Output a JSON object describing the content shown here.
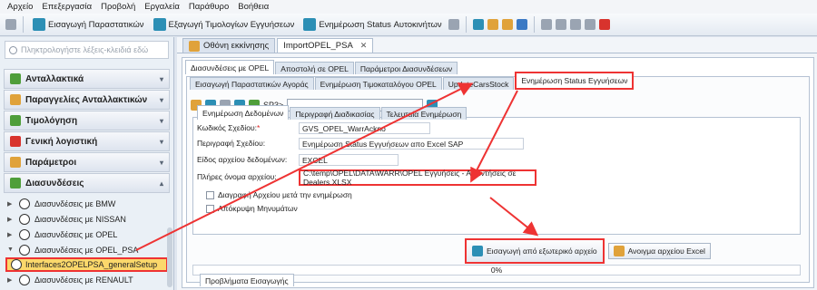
{
  "menu": [
    "Αρχείο",
    "Επεξεργασία",
    "Προβολή",
    "Εργαλεία",
    "Παράθυρο",
    "Βοήθεια"
  ],
  "toolbar": {
    "import_label": "Εισαγωγή Παραστατικών",
    "export_label": "Εξαγωγή Τιμολογίων Εγγυήσεων",
    "status_label": "Ενημέρωση Status Αυτοκινήτων"
  },
  "sidebar": {
    "search_placeholder": "Πληκτρολογήστε λέξεις-κλειδιά εδώ",
    "sections": [
      {
        "label": "Ανταλλακτικά"
      },
      {
        "label": "Παραγγελίες Ανταλλακτικών"
      },
      {
        "label": "Τιμολόγηση"
      },
      {
        "label": "Γενική λογιστική"
      },
      {
        "label": "Παράμετροι"
      },
      {
        "label": "Διασυνδέσεις"
      }
    ],
    "items": [
      {
        "label": "Διασυνδέσεις με BMW"
      },
      {
        "label": "Διασυνδέσεις με NISSAN"
      },
      {
        "label": "Διασυνδέσεις με OPEL"
      },
      {
        "label": "Διασυνδέσεις με OPEL_PSA"
      },
      {
        "label": "Διασυνδέσεις με RENAULT"
      }
    ],
    "selected_item": "Interfaces2OPELPSA_generalSetup"
  },
  "doc_tabs": [
    "Οθόνη εκκίνησης",
    "ImportOPEL_PSA"
  ],
  "top_tabs": [
    "Διασυνδέσεις με OPEL",
    "Αποστολή σε OPEL",
    "Παράμετροι Διασυνδέσεων"
  ],
  "sub_tabs": [
    "Εισαγωγή Παραστατικών Αγοράς",
    "Ενημέρωση Τιμοκαταλόγου OPEL",
    "UpdateCarsStock",
    "Ενημέρωση Status Εγγυήσεων"
  ],
  "mini_toolbar": {
    "sp3_label": "SP3>"
  },
  "inner_tabs": [
    "Ενημέρωση Δεδομένων",
    "Περιγραφή Διαδικασίας",
    "Τελευταία Ενημέρωση"
  ],
  "form": {
    "code_label": "Κωδικός Σχεδίου:",
    "code_value": "GVS_OPEL_WarrAckno",
    "desc_label": "Περιγραφή Σχεδίου:",
    "desc_value": "Ενημέρωση Status Εγγυήσεων απο Excel SAP",
    "type_label": "Είδος αρχείου δεδομένων:",
    "type_value": "EXCEL",
    "path_label": "Πλήρες όνομα αρχείου:",
    "path_value": "C:\\temp\\OPEL\\DATA\\WARR\\OPEL Εγγυήσεις - Απαντήσεις σε Dealers.XLSX",
    "delete_label": "Διαγραφή Αρχείου μετά την ενημέρωση",
    "hide_label": "Απόκρυψη Μηνυμάτων"
  },
  "buttons": {
    "import_external": "Εισαγωγή από εξωτερικό αρχείο",
    "open_excel": "Ανοιγμα αρχείου Excel"
  },
  "progress": {
    "text": "0%",
    "value": 0
  },
  "bottom_tab": "Προβλήματα Εισαγωγής"
}
